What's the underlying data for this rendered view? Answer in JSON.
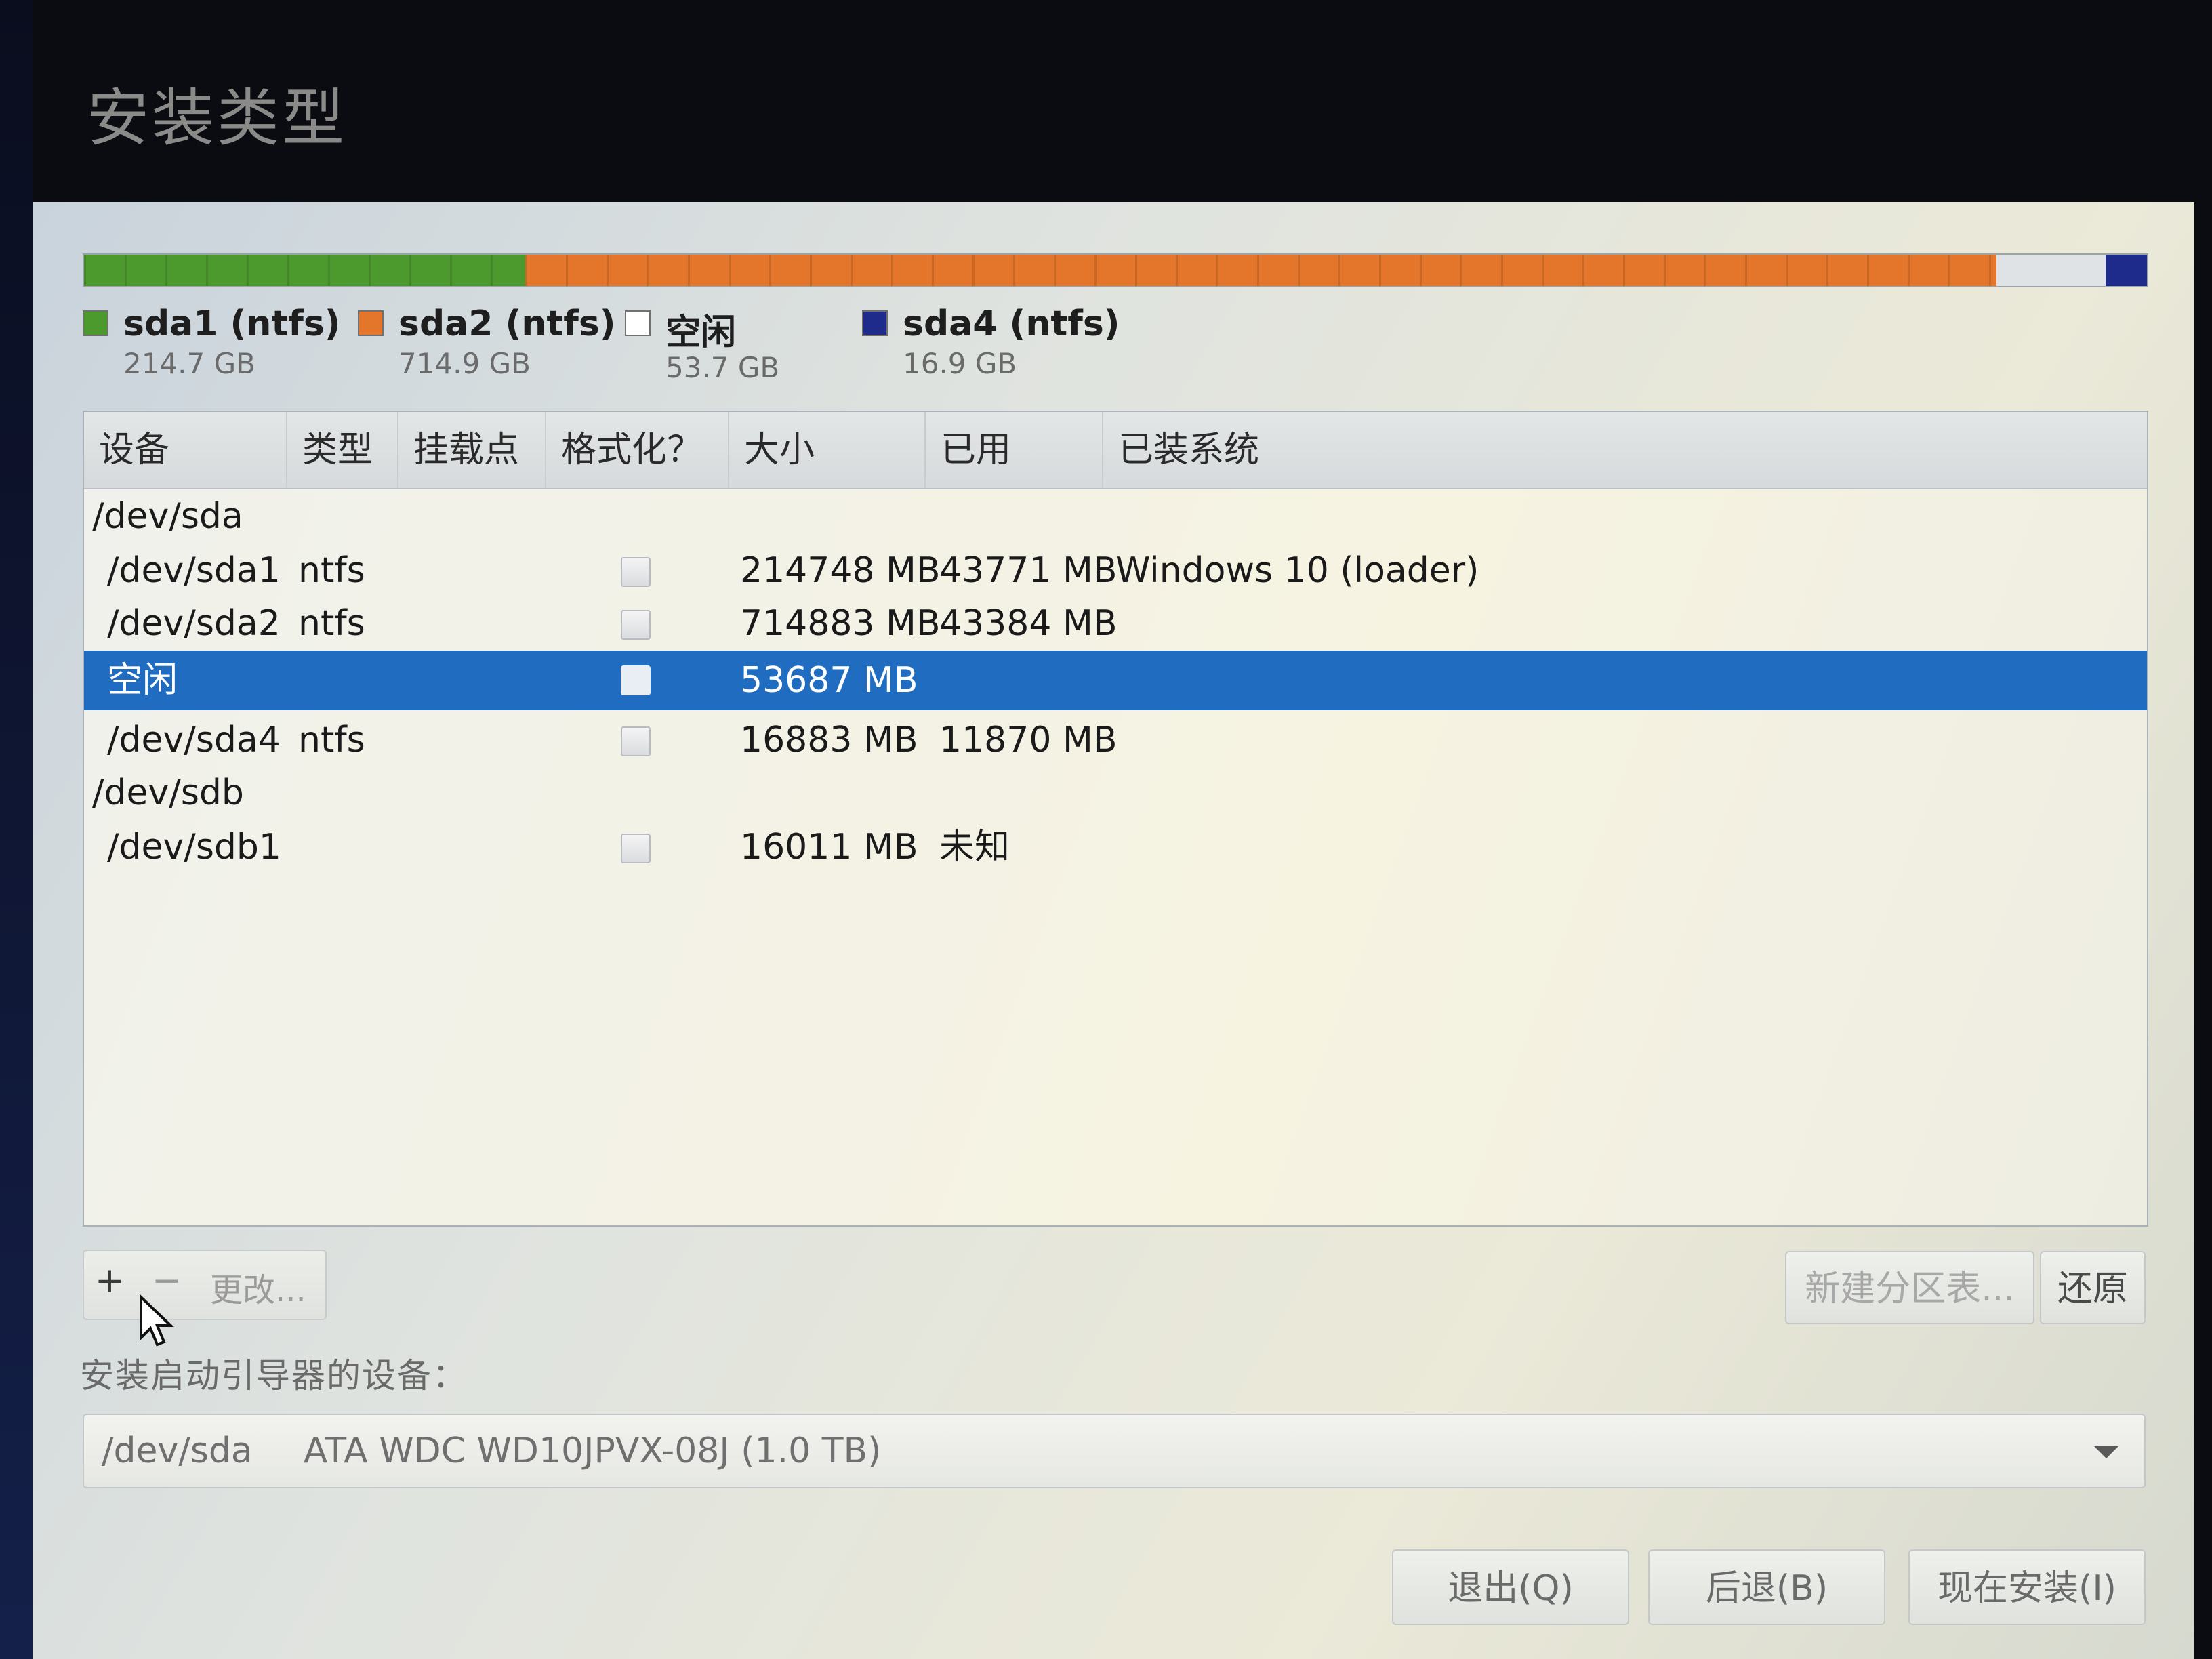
{
  "window": {
    "title": "安装类型"
  },
  "partition_bar": {
    "legend": [
      {
        "name": "sda1 (ntfs)",
        "size": "214.7 GB",
        "color": "#4c9a2d"
      },
      {
        "name": "sda2 (ntfs)",
        "size": "714.9 GB",
        "color": "#e4762c"
      },
      {
        "name": "空闲",
        "size": "53.7 GB",
        "color": "#ffffff"
      },
      {
        "name": "sda4 (ntfs)",
        "size": "16.9 GB",
        "color": "#1e2b8a"
      }
    ]
  },
  "table": {
    "columns": [
      "设备",
      "类型",
      "挂载点",
      "格式化？",
      "大小",
      "已用",
      "已装系统"
    ],
    "rows": [
      {
        "device": "/dev/sda",
        "type": "",
        "size": "",
        "used": "",
        "system": ""
      },
      {
        "device": "/dev/sda1",
        "type": "ntfs",
        "size": "214748 MB",
        "used": "43771 MB",
        "system": "Windows 10 (loader)",
        "format": false
      },
      {
        "device": "/dev/sda2",
        "type": "ntfs",
        "size": "714883 MB",
        "used": "43384 MB",
        "system": "",
        "format": false
      },
      {
        "device": "空闲",
        "type": "",
        "size": "53687 MB",
        "used": "",
        "system": "",
        "format": false,
        "selected": true
      },
      {
        "device": "/dev/sda4",
        "type": "ntfs",
        "size": "16883 MB",
        "used": "11870 MB",
        "system": "",
        "format": false
      },
      {
        "device": "/dev/sdb",
        "type": "",
        "size": "",
        "used": "",
        "system": ""
      },
      {
        "device": "/dev/sdb1",
        "type": "",
        "size": "16011 MB",
        "used": "未知",
        "system": "",
        "format": false
      }
    ]
  },
  "toolbar": {
    "add_label": "+",
    "remove_label": "−",
    "change_label": "更改...",
    "new_table_label": "新建分区表...",
    "revert_label": "还原"
  },
  "bootloader": {
    "label": "安装启动引导器的设备：",
    "device": "/dev/sda",
    "description": "ATA WDC WD10JPVX-08J (1.0 TB)"
  },
  "buttons": {
    "quit": "退出(Q)",
    "back": "后退(B)",
    "install_now": "现在安装(I)"
  }
}
